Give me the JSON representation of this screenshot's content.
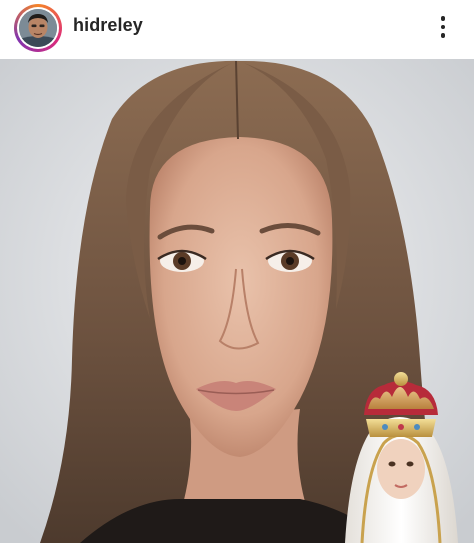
{
  "post": {
    "username": "hidreley",
    "avatar_icon": "profile-photo",
    "more_icon": "more-vertical-icon",
    "image": {
      "subject": "portrait-photo",
      "overlay": "statue-with-crown"
    }
  },
  "colors": {
    "story_ring": "#dd2a7b",
    "text": "#262626",
    "background": "#ffffff"
  }
}
